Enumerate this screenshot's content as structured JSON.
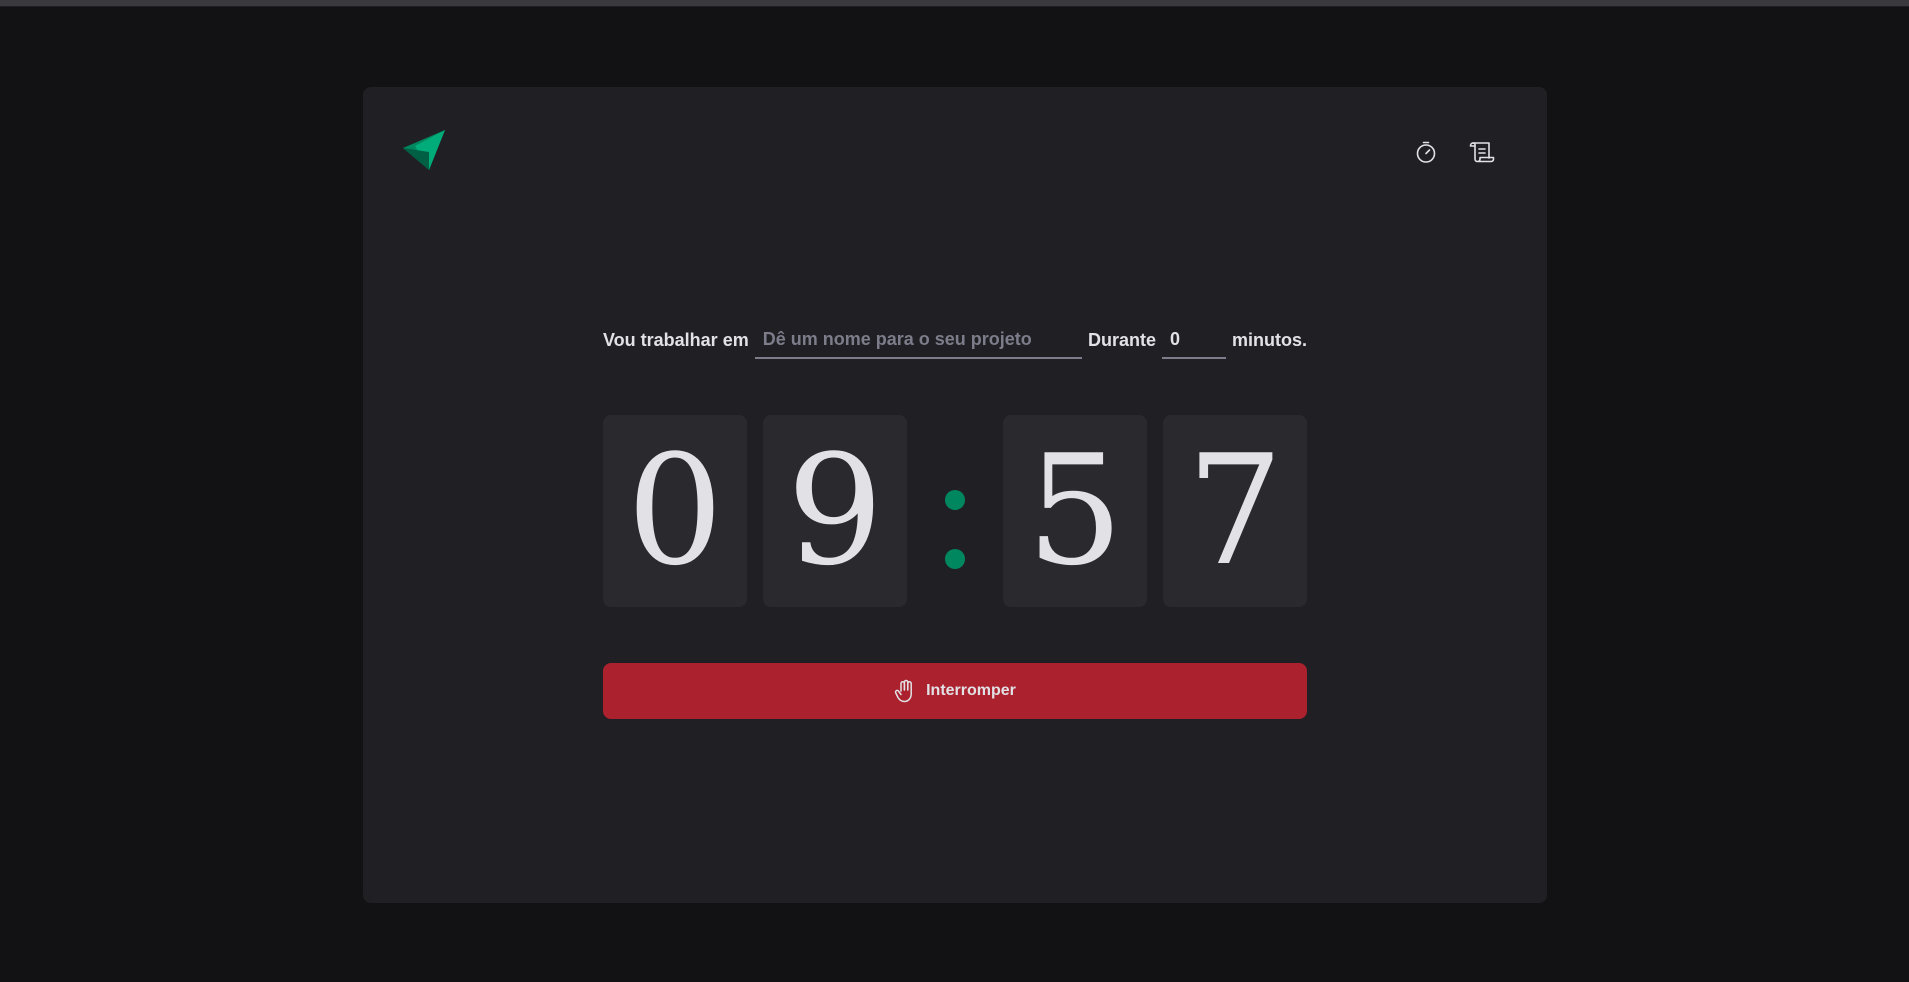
{
  "colors": {
    "background": "#121214",
    "card": "#202024",
    "digit_bg": "#29292E",
    "accent_green": "#00875F",
    "stop_red": "#AB222E",
    "text": "#E1E1E6",
    "muted": "#7C7C8A"
  },
  "header": {
    "logo_icon": "paper-plane-logo-icon",
    "nav": [
      {
        "icon": "timer-icon"
      },
      {
        "icon": "scroll-history-icon"
      }
    ]
  },
  "form": {
    "task_label": "Vou trabalhar em",
    "task_placeholder": "Dê um nome para o seu projeto",
    "task_value": "",
    "during_label": "Durante",
    "minutes_value": "0",
    "minutes_suffix": "minutos."
  },
  "countdown": {
    "digits": [
      "0",
      "9",
      "5",
      "7"
    ],
    "separator": ":"
  },
  "stop_button": {
    "icon": "hand-palm-icon",
    "label": "Interromper"
  }
}
